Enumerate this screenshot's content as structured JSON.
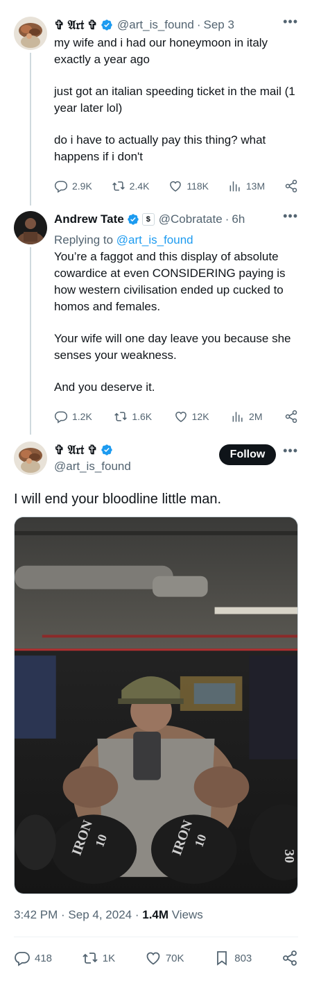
{
  "colors": {
    "text": "#0f1419",
    "secondary": "#536471",
    "link": "#1d9bf0",
    "verified": "#1d9bf0",
    "border": "#cfd9de"
  },
  "tweet1": {
    "name": "✞ 𝔄𝔯𝔱 ✞",
    "handle": "@art_is_found",
    "separator": "·",
    "time": "Sep 3",
    "paragraphs": [
      "my wife and i had our honeymoon in italy exactly a year ago",
      "just got an italian speeding ticket in the mail (1 year later lol)",
      "do i have to actually pay this thing? what happens if i don't"
    ],
    "replies": "2.9K",
    "retweets": "2.4K",
    "likes": "118K",
    "views": "13M"
  },
  "tweet2": {
    "name": "Andrew Tate",
    "affiliate_badge": "$",
    "handle": "@Cobratate",
    "separator": "·",
    "time": "6h",
    "replying_prefix": "Replying to",
    "replying_handle": "@art_is_found",
    "paragraphs": [
      "You’re a faggot and this display of absolute cowardice at even CONSIDERING paying is how western civilisation ended up cucked to homos and females.",
      "Your wife will one day leave you because she senses your weakness.",
      "And you deserve it."
    ],
    "replies": "1.2K",
    "retweets": "1.6K",
    "likes": "12K",
    "views": "2M"
  },
  "main_tweet": {
    "name": "✞ 𝔄𝔯𝔱 ✞",
    "handle": "@art_is_found",
    "follow_label": "Follow",
    "text": "I will end your bloodline little man.",
    "time": "3:42 PM",
    "sep1": " · ",
    "date": "Sep 4, 2024",
    "sep2": " · ",
    "views_count": "1.4M",
    "views_label": " Views",
    "replies": "418",
    "retweets": "1K",
    "likes": "70K",
    "bookmarks": "803"
  },
  "photo": {
    "dumbbell_labels": [
      "IRON",
      "10",
      "IRON",
      "10",
      "30"
    ]
  },
  "icons": {
    "more": "more-horizontal-icon",
    "reply": "reply-icon",
    "retweet": "retweet-icon",
    "like": "heart-icon",
    "views": "views-bar-icon",
    "share": "share-icon",
    "bookmark": "bookmark-icon",
    "verified": "verified-badge-icon"
  }
}
